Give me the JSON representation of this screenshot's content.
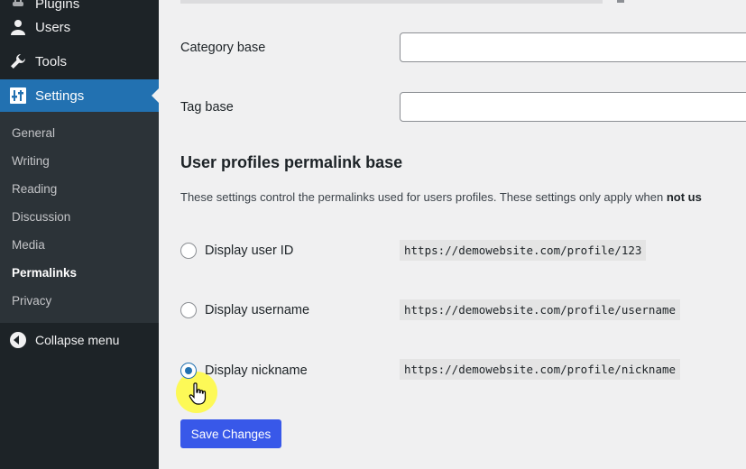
{
  "sidebar": {
    "top_partial_label": "Plugins",
    "menu": [
      {
        "label": "Users",
        "icon": "users-icon"
      },
      {
        "label": "Tools",
        "icon": "wrench-icon"
      },
      {
        "label": "Settings",
        "icon": "settings-sliders-icon",
        "current": true
      }
    ],
    "submenu": [
      {
        "label": "General"
      },
      {
        "label": "Writing"
      },
      {
        "label": "Reading"
      },
      {
        "label": "Discussion"
      },
      {
        "label": "Media"
      },
      {
        "label": "Permalinks",
        "active": true
      },
      {
        "label": "Privacy"
      }
    ],
    "collapse_label": "Collapse menu"
  },
  "main": {
    "category_base": {
      "label": "Category base",
      "value": ""
    },
    "tag_base": {
      "label": "Tag base",
      "value": ""
    },
    "section_title": "User profiles permalink base",
    "description_text": "These settings control the permalinks used for users profiles. These settings only apply when ",
    "description_bold": "not us",
    "options": [
      {
        "label": "Display user ID",
        "example": "https://demowebsite.com/profile/123",
        "checked": false
      },
      {
        "label": "Display username",
        "example": "https://demowebsite.com/profile/username",
        "checked": false
      },
      {
        "label": "Display nickname",
        "example": "https://demowebsite.com/profile/nickname",
        "checked": true
      }
    ],
    "save_label": "Save Changes"
  },
  "colors": {
    "sidebar_bg": "#1d2327",
    "submenu_bg": "#2c3338",
    "current_menu": "#2271b1",
    "primary_button": "#3858e9",
    "page_bg": "#f0f0f1"
  }
}
